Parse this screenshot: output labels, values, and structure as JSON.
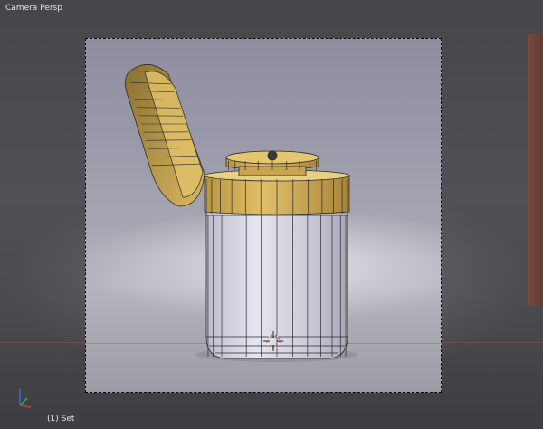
{
  "viewport": {
    "view_label": "Camera Persp",
    "object_label": "(1) Set"
  },
  "colors": {
    "lid": "#d4b055",
    "jar": "#c7c7d6",
    "wire": "#2a2a2a",
    "axis_x": "#d23b3b",
    "axis_y": "#3bb34a",
    "axis_z": "#3b6bd2"
  },
  "icons": {
    "axis_gizmo": "axis-gizmo-icon",
    "cursor": "3d-cursor-icon"
  }
}
